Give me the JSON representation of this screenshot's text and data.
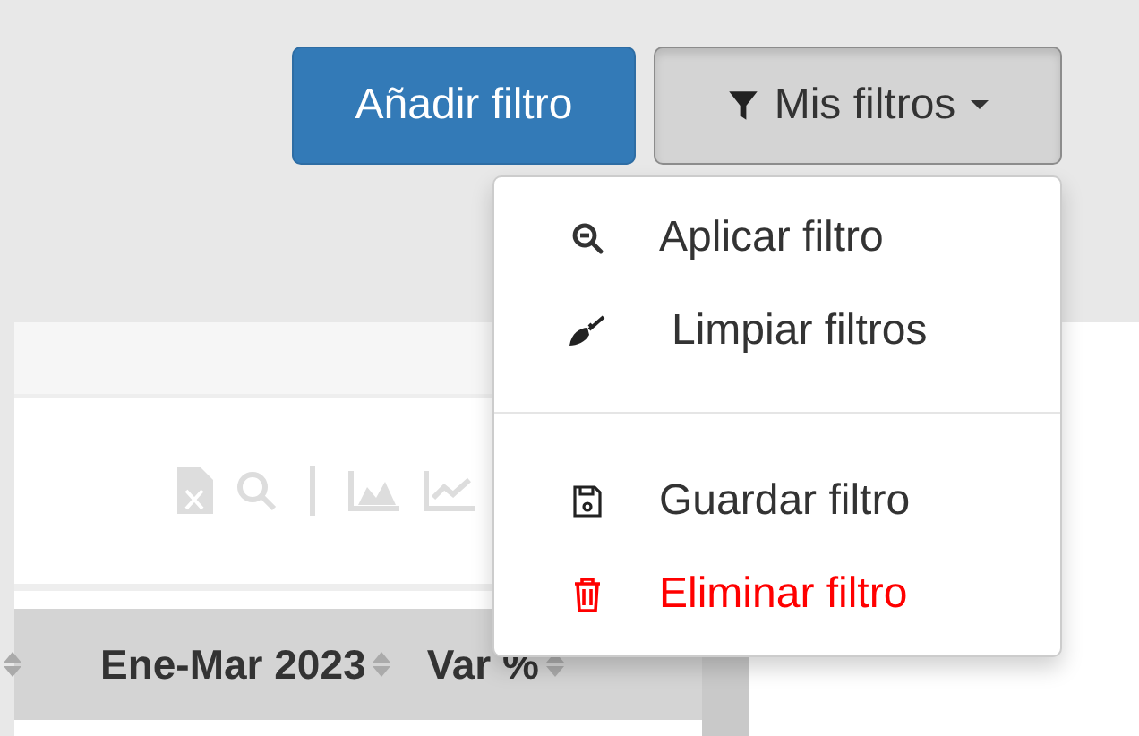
{
  "toolbar": {
    "add_button": "Añadir filtro",
    "filters_button": "Mis filtros"
  },
  "filters_menu": {
    "expanded": true,
    "items": [
      {
        "kind": "zoom",
        "label": "Aplicar filtro",
        "danger": false
      },
      {
        "kind": "brush",
        "label": "Limpiar filtros",
        "danger": false
      },
      {
        "kind": "divider"
      },
      {
        "kind": "save",
        "label": "Guardar filtro",
        "danger": false
      },
      {
        "kind": "trash",
        "label": "Eliminar filtro",
        "danger": true
      }
    ]
  },
  "table": {
    "columns": [
      {
        "label": "Ene-Mar 2023"
      },
      {
        "label": "Var %"
      }
    ]
  }
}
